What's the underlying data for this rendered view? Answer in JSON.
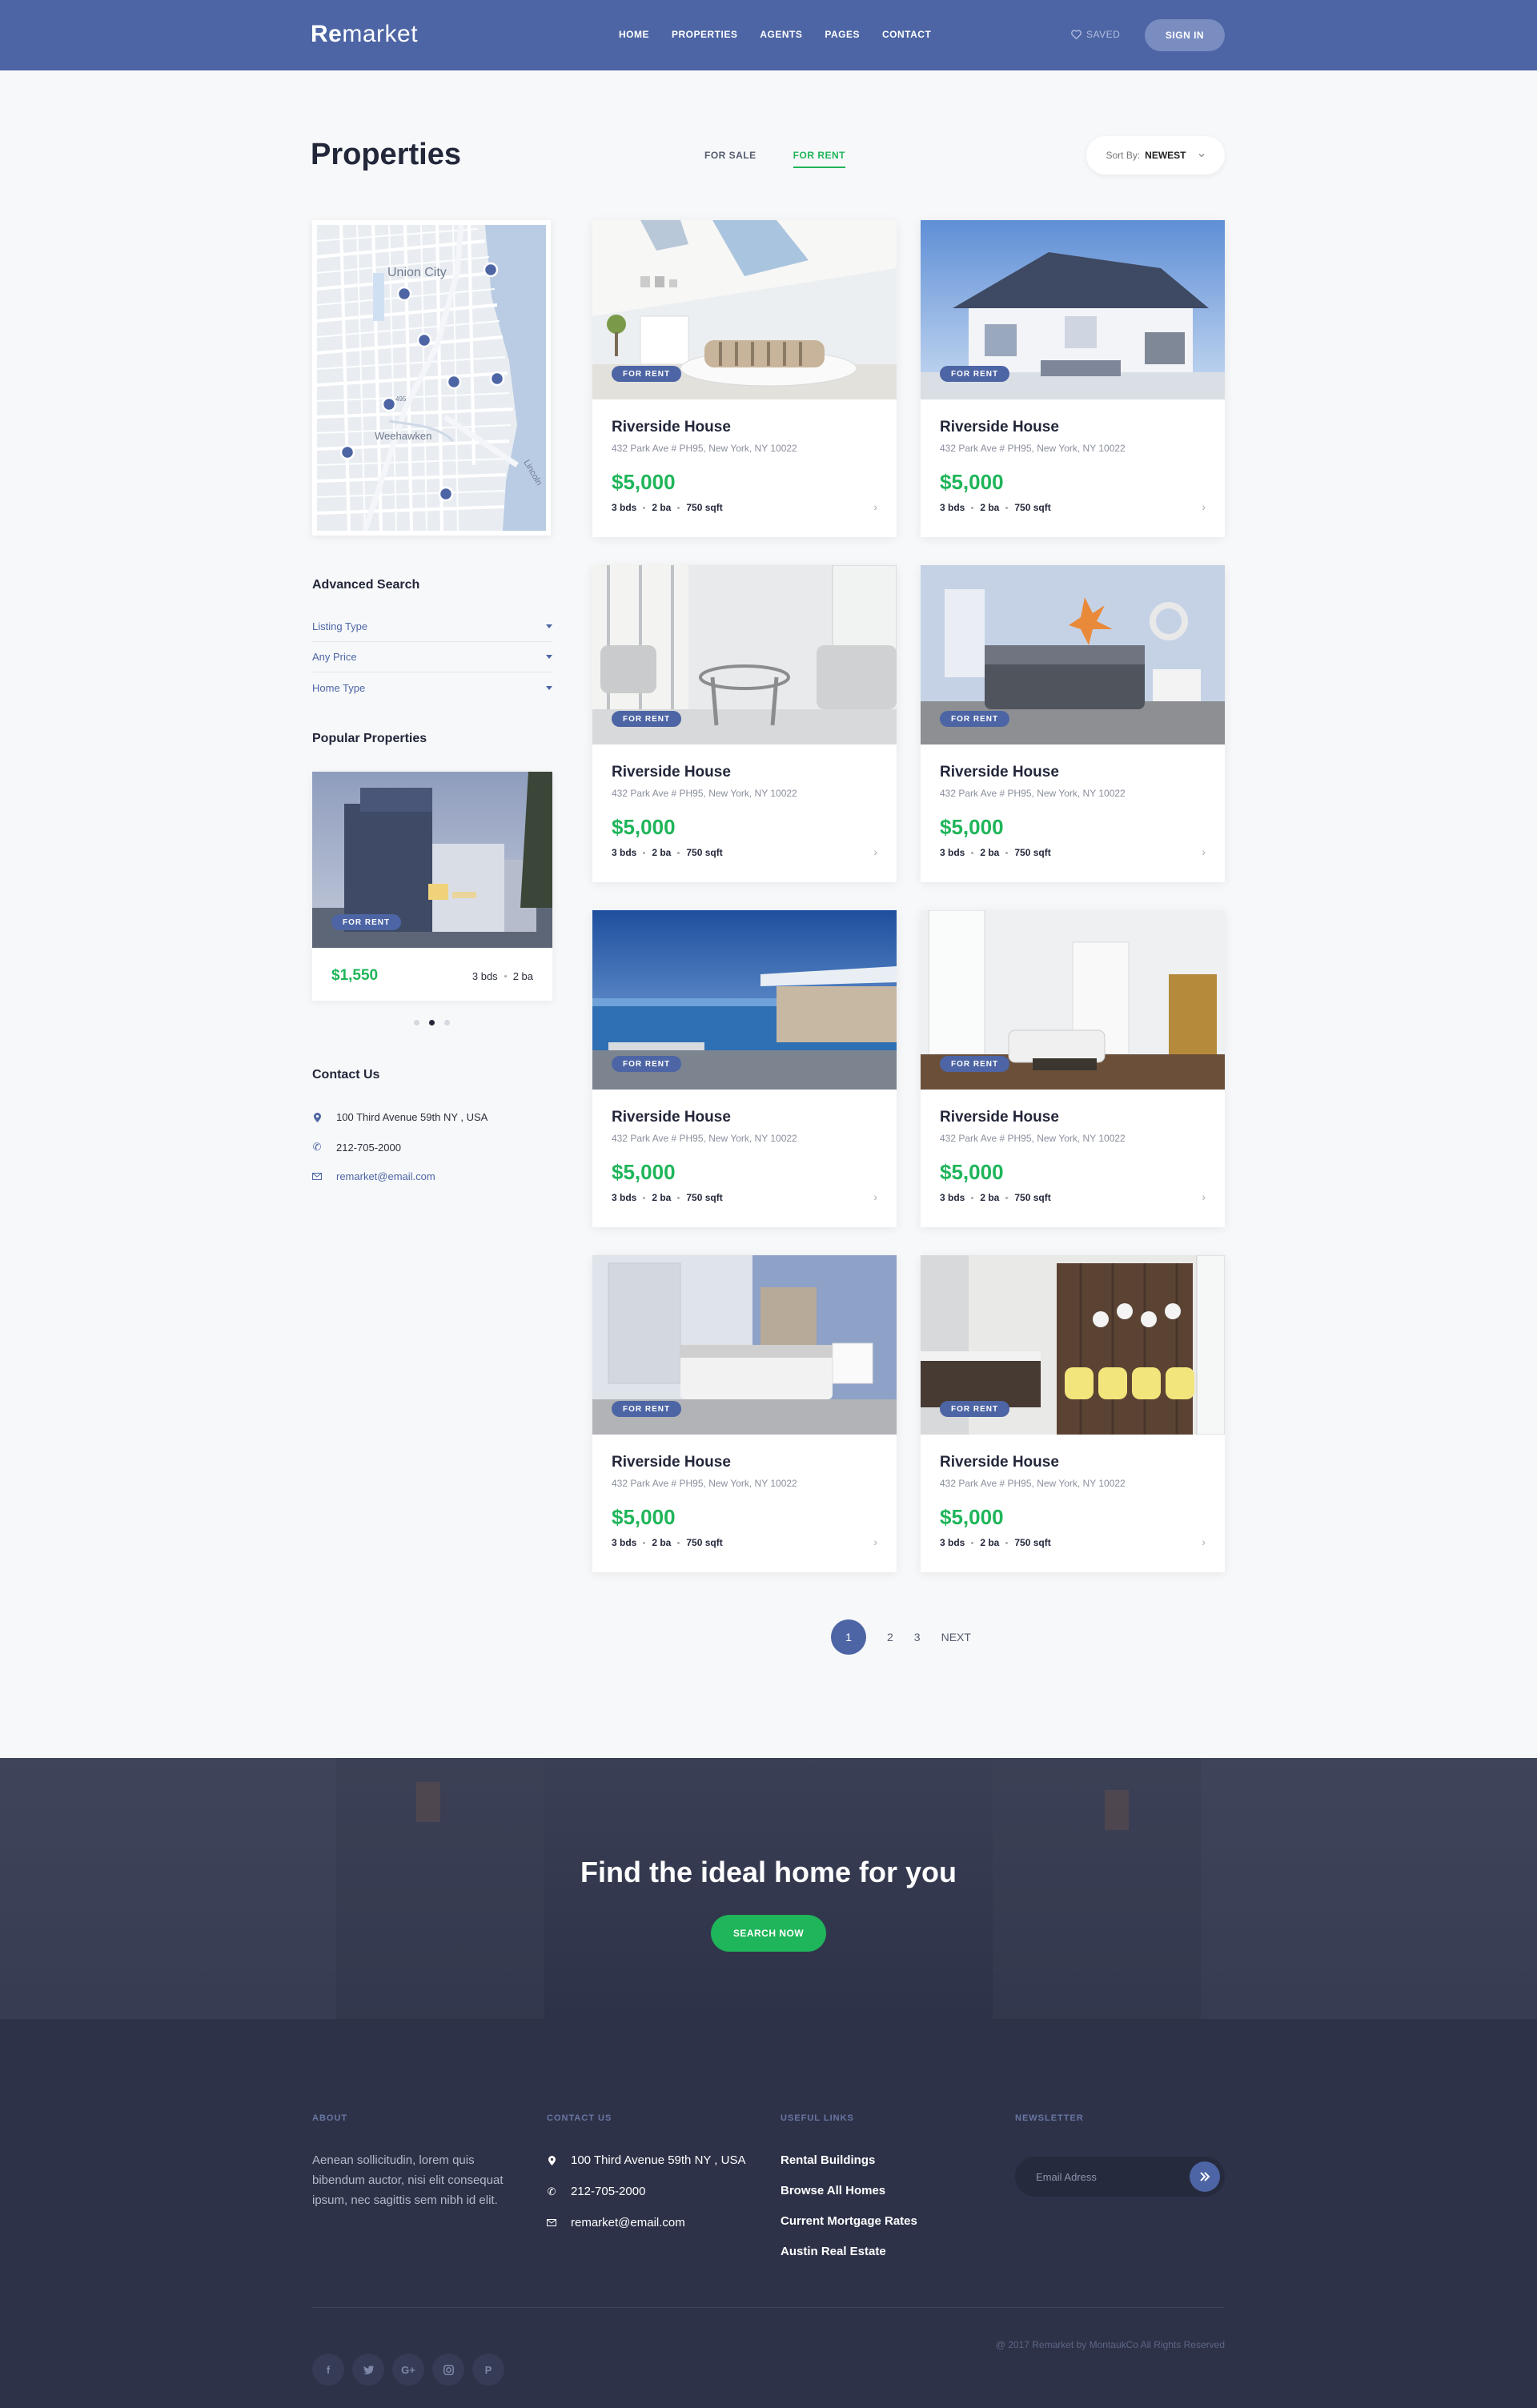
{
  "header": {
    "logo_bold": "Re",
    "logo_rest": "market",
    "nav": [
      "HOME",
      "PROPERTIES",
      "AGENTS",
      "PAGES",
      "CONTACT"
    ],
    "saved_label": "SAVED",
    "signin_label": "SIGN IN"
  },
  "page": {
    "title": "Properties",
    "tabs": [
      {
        "label": "FOR SALE"
      },
      {
        "label": "FOR RENT"
      }
    ],
    "active_tab": "FOR RENT",
    "sort_prefix": "Sort By:",
    "sort_value": "NEWEST"
  },
  "map": {
    "labels": [
      "Union City",
      "Weehawken",
      "495",
      "Lincoln"
    ]
  },
  "sidebar": {
    "advanced_search_title": "Advanced Search",
    "filters": [
      "Listing Type",
      "Any Price",
      "Home Type"
    ],
    "popular_title": "Popular Properties",
    "popular": {
      "badge": "FOR RENT",
      "price": "$1,550",
      "beds": "3 bds",
      "baths": "2 ba"
    },
    "carousel_active": 2,
    "contact_title": "Contact Us",
    "contact": {
      "address": "100 Third Avenue 59th NY , USA",
      "phone": "212-705-2000",
      "email": "remarket@email.com"
    }
  },
  "listings": [
    {
      "badge": "FOR RENT",
      "name": "Riverside House",
      "address": "432 Park Ave # PH95, New York, NY 10022",
      "price": "$5,000",
      "beds": "3 bds",
      "baths": "2 ba",
      "area": "750 sqft"
    },
    {
      "badge": "FOR RENT",
      "name": "Riverside House",
      "address": "432 Park Ave # PH95, New York, NY 10022",
      "price": "$5,000",
      "beds": "3 bds",
      "baths": "2 ba",
      "area": "750 sqft"
    },
    {
      "badge": "FOR RENT",
      "name": "Riverside House",
      "address": "432 Park Ave # PH95, New York, NY 10022",
      "price": "$5,000",
      "beds": "3 bds",
      "baths": "2 ba",
      "area": "750 sqft"
    },
    {
      "badge": "FOR RENT",
      "name": "Riverside House",
      "address": "432 Park Ave # PH95, New York, NY 10022",
      "price": "$5,000",
      "beds": "3 bds",
      "baths": "2 ba",
      "area": "750 sqft"
    },
    {
      "badge": "FOR RENT",
      "name": "Riverside House",
      "address": "432 Park Ave # PH95, New York, NY 10022",
      "price": "$5,000",
      "beds": "3 bds",
      "baths": "2 ba",
      "area": "750 sqft"
    },
    {
      "badge": "FOR RENT",
      "name": "Riverside House",
      "address": "432 Park Ave # PH95, New York, NY 10022",
      "price": "$5,000",
      "beds": "3 bds",
      "baths": "2 ba",
      "area": "750 sqft"
    },
    {
      "badge": "FOR RENT",
      "name": "Riverside House",
      "address": "432 Park Ave # PH95, New York, NY 10022",
      "price": "$5,000",
      "beds": "3 bds",
      "baths": "2 ba",
      "area": "750 sqft"
    },
    {
      "badge": "FOR RENT",
      "name": "Riverside House",
      "address": "432 Park Ave # PH95, New York, NY 10022",
      "price": "$5,000",
      "beds": "3 bds",
      "baths": "2 ba",
      "area": "750 sqft"
    }
  ],
  "pagination": {
    "pages": [
      "1",
      "2",
      "3"
    ],
    "current": "1",
    "next_label": "NEXT"
  },
  "cta": {
    "title": "Find the ideal home for you",
    "button": "SEARCH NOW"
  },
  "footer": {
    "about_title": "ABOUT",
    "about_text": "Aenean sollicitudin, lorem quis bibendum auctor, nisi elit consequat ipsum, nec sagittis sem nibh id elit.",
    "contact_title": "CONTACT US",
    "contact": {
      "address": "100 Third Avenue 59th NY , USA",
      "phone": "212-705-2000",
      "email": "remarket@email.com"
    },
    "links_title": "USEFUL LINKS",
    "links": [
      "Rental Buildings",
      "Browse All Homes",
      "Current Mortgage Rates",
      "Austin Real Estate"
    ],
    "newsletter_title": "NEWSLETTER",
    "newsletter_placeholder": "Email Adress",
    "socials": [
      "facebook-icon",
      "twitter-icon",
      "google-plus-icon",
      "instagram-icon",
      "pinterest-icon"
    ],
    "copyright": "@ 2017 Remarket by MontaukCo All Rights Reserved"
  },
  "colors": {
    "brand": "#4d65a4",
    "accent_green": "#1fb55a",
    "footer_bg": "#2d3248"
  }
}
